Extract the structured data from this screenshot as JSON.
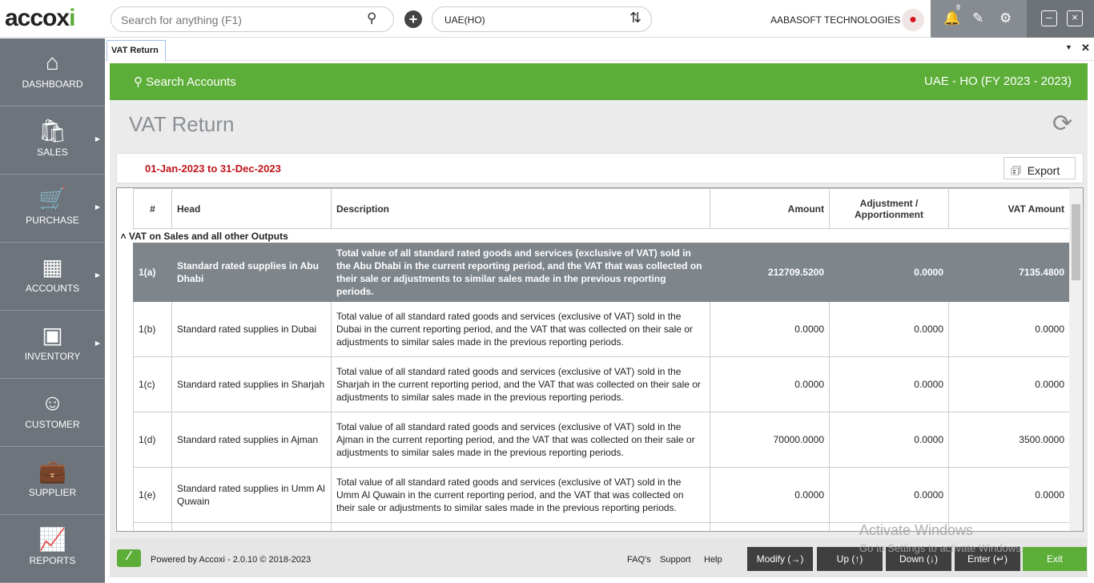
{
  "app": {
    "logo": "accoxi",
    "search_placeholder": "Search for anything (F1)",
    "branch": "UAE(HO)",
    "company": "AABASOFT TECHNOLOGIES",
    "notification_count": "8"
  },
  "sidebar": {
    "items": [
      {
        "label": "DASHBOARD",
        "icon": "home-icon"
      },
      {
        "label": "SALES",
        "icon": "shopping-bag-icon"
      },
      {
        "label": "PURCHASE",
        "icon": "cart-icon"
      },
      {
        "label": "ACCOUNTS",
        "icon": "calculator-icon"
      },
      {
        "label": "INVENTORY",
        "icon": "inventory-icon"
      },
      {
        "label": "CUSTOMER",
        "icon": "user-icon"
      },
      {
        "label": "SUPPLIER",
        "icon": "briefcase-icon"
      },
      {
        "label": "REPORTS",
        "icon": "chart-icon"
      }
    ]
  },
  "tab": {
    "label": "VAT Return"
  },
  "header": {
    "search_accounts": "Search Accounts",
    "fiscal": "UAE - HO (FY 2023 - 2023)",
    "title": "VAT Return",
    "date_range": "01-Jan-2023 to 31-Dec-2023",
    "export": "Export"
  },
  "table": {
    "columns": [
      "#",
      "Head",
      "Description",
      "Amount",
      "Adjustment / Apportionment",
      "VAT Amount"
    ],
    "group": "VAT on Sales and all other Outputs",
    "rows": [
      {
        "no": "1(a)",
        "head": "Standard rated supplies in Abu Dhabi",
        "desc": "Total value of all standard rated goods and services (exclusive of VAT) sold in the Abu Dhabi in the current reporting period, and the VAT that was collected on their sale or adjustments to similar sales made in the previous reporting periods.",
        "amount": "212709.5200",
        "adj": "0.0000",
        "vat": "7135.4800"
      },
      {
        "no": "1(b)",
        "head": "Standard rated supplies in Dubai",
        "desc": "Total value of all standard rated goods and services (exclusive of VAT) sold in the Dubai in the current reporting period, and the VAT that was collected on their sale or adjustments to similar sales made in the previous reporting periods.",
        "amount": "0.0000",
        "adj": "0.0000",
        "vat": "0.0000"
      },
      {
        "no": "1(c)",
        "head": "Standard rated supplies in Sharjah",
        "desc": "Total value of all standard rated goods and services (exclusive of VAT) sold in the Sharjah in the current reporting period, and the VAT that was collected on their sale or adjustments to similar sales made in the previous reporting periods.",
        "amount": "0.0000",
        "adj": "0.0000",
        "vat": "0.0000"
      },
      {
        "no": "1(d)",
        "head": "Standard rated supplies in Ajman",
        "desc": "Total value of all standard rated goods and services (exclusive of VAT) sold in the Ajman in the current reporting period, and the VAT that was collected on their sale or adjustments to similar sales made in the previous reporting periods.",
        "amount": "70000.0000",
        "adj": "0.0000",
        "vat": "3500.0000"
      },
      {
        "no": "1(e)",
        "head": "Standard rated supplies in Umm Al Quwain",
        "desc": "Total value of all standard rated goods and services (exclusive of VAT) sold in the Umm Al Quwain in the current reporting period, and the VAT that was collected on their sale or adjustments to similar sales made in the previous reporting periods.",
        "amount": "0.0000",
        "adj": "0.0000",
        "vat": "0.0000"
      }
    ]
  },
  "footer": {
    "powered": "Powered by Accoxi - 2.0.10 © 2018-2023",
    "faq": "FAQ's",
    "support": "Support",
    "help": "Help",
    "modify": "Modify (→)",
    "up": "Up (↑)",
    "down": "Down (↓)",
    "enter": "Enter (↵)",
    "exit": "Exit"
  },
  "watermark": {
    "line1": "Activate Windows",
    "line2": "Go to Settings to activate Windows."
  },
  "colors": {
    "brand_green": "#5cae38",
    "sidebar": "#6d747b",
    "date_red": "#c0141b",
    "selected_row": "#7e858b"
  }
}
